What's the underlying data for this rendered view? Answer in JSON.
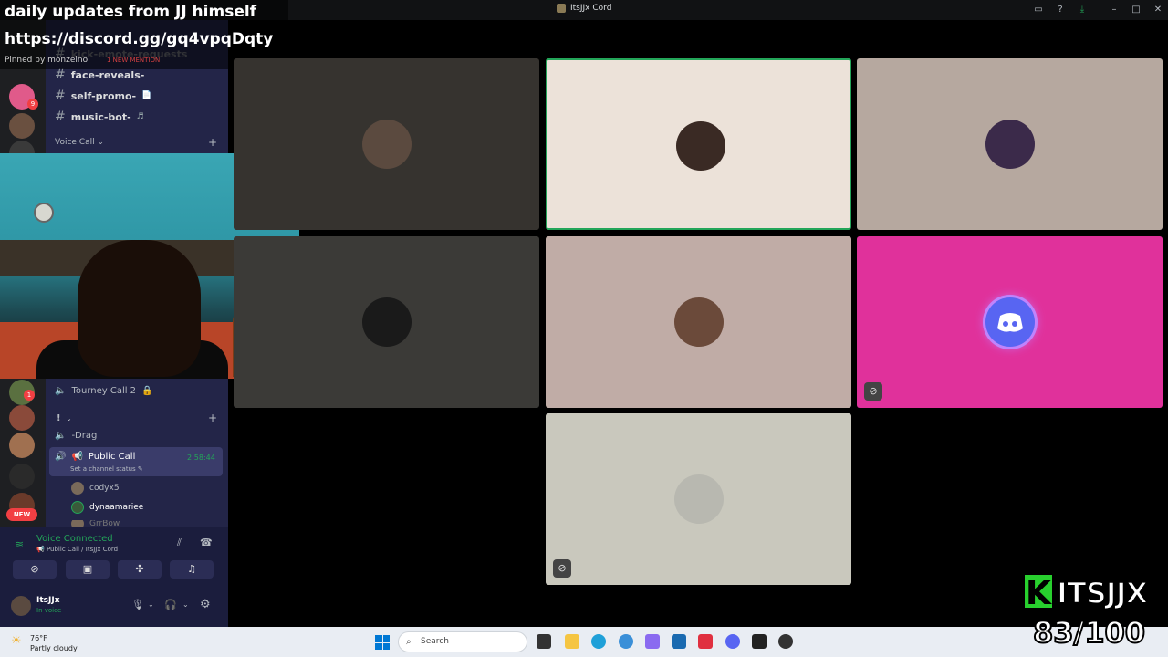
{
  "window": {
    "title": "ItsJJx Cord"
  },
  "overlay": {
    "line1": "daily updates from JJ himself",
    "line2": "https://discord.gg/gq4vpqDqty",
    "pinned": "Pinned by monzeino",
    "tag": "1 NEW MENTION"
  },
  "channels": {
    "faded1": "kick-emote-requests",
    "item1": "face-reveals-",
    "item2": "self-promo-",
    "item3": "music-bot-",
    "voice_category": "Voice Call",
    "tourney": "Tourney Call 2",
    "bang": "!",
    "drag": "-Drag",
    "public_call": "Public Call",
    "public_call_time": "2:58:44",
    "set_status": "Set a channel status",
    "members": [
      "codyx5",
      "dynaamariee",
      "GrrBow"
    ]
  },
  "servers": {
    "badge1": "9",
    "badge2": "1",
    "new_badge": "NEW"
  },
  "voice_panel": {
    "status": "Voice Connected",
    "location": "Public Call / ItsJJx Cord",
    "username": "ItsJJx",
    "user_status": "In voice"
  },
  "taskbar": {
    "temp": "76°F",
    "weather": "Partly cloudy",
    "search_placeholder": "Search"
  },
  "tiles": [
    {
      "bg": "#36332f",
      "avatar": "#5b4a3f"
    },
    {
      "bg": "#ece2d9",
      "avatar": "#3a2a24"
    },
    {
      "bg": "#b6a89f",
      "avatar": "#3b2a4a"
    },
    {
      "bg": "#3b3a37",
      "avatar": "#1a1a1a"
    },
    {
      "bg": "#c0aca6",
      "avatar": "#6b4a3a"
    },
    {
      "bg": "#e0319b",
      "avatar": "#5865f2"
    },
    {
      "bg": "#c9c8bd",
      "avatar": "#b8b8b0"
    }
  ],
  "brand": {
    "k": "K",
    "name": "ITSJJX",
    "counter": "83/100"
  }
}
